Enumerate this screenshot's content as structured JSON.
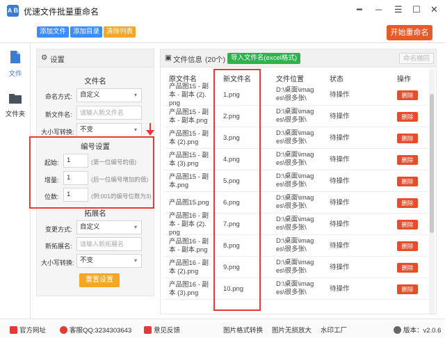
{
  "app": {
    "title": "优速文件批量重命名",
    "logo_text": "A B"
  },
  "toolbar": {
    "add_file": "添加文件",
    "add_dir": "添加目录",
    "clear_list": "清除列表",
    "start_rename": "开始重命名"
  },
  "sidebar": {
    "items": [
      {
        "label": "文件"
      },
      {
        "label": "文件夹"
      }
    ]
  },
  "settings": {
    "header": "设置",
    "filename": {
      "title": "文件名",
      "mode_label": "命名方式:",
      "mode_value": "自定义",
      "new_name_label": "新文件名:",
      "new_name_placeholder": "请输入新文件名",
      "case_label": "大小写转换:",
      "case_value": "不变"
    },
    "numbering": {
      "title": "编号设置",
      "start_label": "起始:",
      "start_value": "1",
      "start_hint": "(第一位编号的值)",
      "step_label": "增量:",
      "step_value": "1",
      "step_hint": "(后一位编号增加的值)",
      "digits_label": "位数:",
      "digits_value": "1",
      "digits_hint": "(例:001的编号位数为3)"
    },
    "extension": {
      "title": "拓展名",
      "mode_label": "变更方式:",
      "mode_value": "自定义",
      "new_ext_label": "新拓展名:",
      "new_ext_placeholder": "请输入新拓展名",
      "case_label": "大小写转换:",
      "case_value": "不变"
    },
    "reset": "重置设置"
  },
  "file_info": {
    "header": "文件信息",
    "count": "(20个)",
    "import_btn": "导入文件名(excel格式)",
    "undo_btn": "命名撤回",
    "columns": [
      "原文件名",
      "新文件名",
      "文件位置",
      "状态",
      "操作"
    ],
    "delete_label": "删除",
    "rows": [
      {
        "orig": [
          "产品图15 - 副",
          "本 - 副本 (2).",
          "png"
        ],
        "new": "1.png",
        "loc": [
          "D:\\桌面\\imag",
          "es\\很多张\\"
        ],
        "status": "待操作"
      },
      {
        "orig": [
          "产品图15 - 副",
          "本 - 副本.png"
        ],
        "new": "2.png",
        "loc": [
          "D:\\桌面\\imag",
          "es\\很多张\\"
        ],
        "status": "待操作"
      },
      {
        "orig": [
          "产品图15 - 副",
          "本 (2).png"
        ],
        "new": "3.png",
        "loc": [
          "D:\\桌面\\imag",
          "es\\很多张\\"
        ],
        "status": "待操作"
      },
      {
        "orig": [
          "产品图15 - 副",
          "本 (3).png"
        ],
        "new": "4.png",
        "loc": [
          "D:\\桌面\\imag",
          "es\\很多张\\"
        ],
        "status": "待操作"
      },
      {
        "orig": [
          "产品图15 - 副",
          "本.png"
        ],
        "new": "5.png",
        "loc": [
          "D:\\桌面\\imag",
          "es\\很多张\\"
        ],
        "status": "待操作"
      },
      {
        "orig": [
          "产品图15.png"
        ],
        "new": "6.png",
        "loc": [
          "D:\\桌面\\imag",
          "es\\很多张\\"
        ],
        "status": "待操作"
      },
      {
        "orig": [
          "产品图16 - 副",
          "本 - 副本 (2).",
          "png"
        ],
        "new": "7.png",
        "loc": [
          "D:\\桌面\\imag",
          "es\\很多张\\"
        ],
        "status": "待操作"
      },
      {
        "orig": [
          "产品图16 - 副",
          "本 - 副本.png"
        ],
        "new": "8.png",
        "loc": [
          "D:\\桌面\\imag",
          "es\\很多张\\"
        ],
        "status": "待操作"
      },
      {
        "orig": [
          "产品图16 - 副",
          "本 (2).png"
        ],
        "new": "9.png",
        "loc": [
          "D:\\桌面\\imag",
          "es\\很多张\\"
        ],
        "status": "待操作"
      },
      {
        "orig": [
          "产品图16 - 副",
          "本 (3).png"
        ],
        "new": "10.png",
        "loc": [
          "D:\\桌面\\imag",
          "es\\很多张\\"
        ],
        "status": "待操作"
      }
    ]
  },
  "statusbar": {
    "website": "官方网址",
    "qq": "客服QQ:3234303643",
    "feedback": "意见反馈",
    "convert": "图片格式转换",
    "upscale": "图片无损放大",
    "watermark": "水印工厂",
    "version": "版本：v2.0.6"
  },
  "colors": {
    "accent_blue": "#3b8cff",
    "start_orange": "#e95a26",
    "import_green": "#2db24e",
    "delete_red": "#e74c2b",
    "highlight_red": "#e53935",
    "reset_orange": "#f5a623"
  }
}
